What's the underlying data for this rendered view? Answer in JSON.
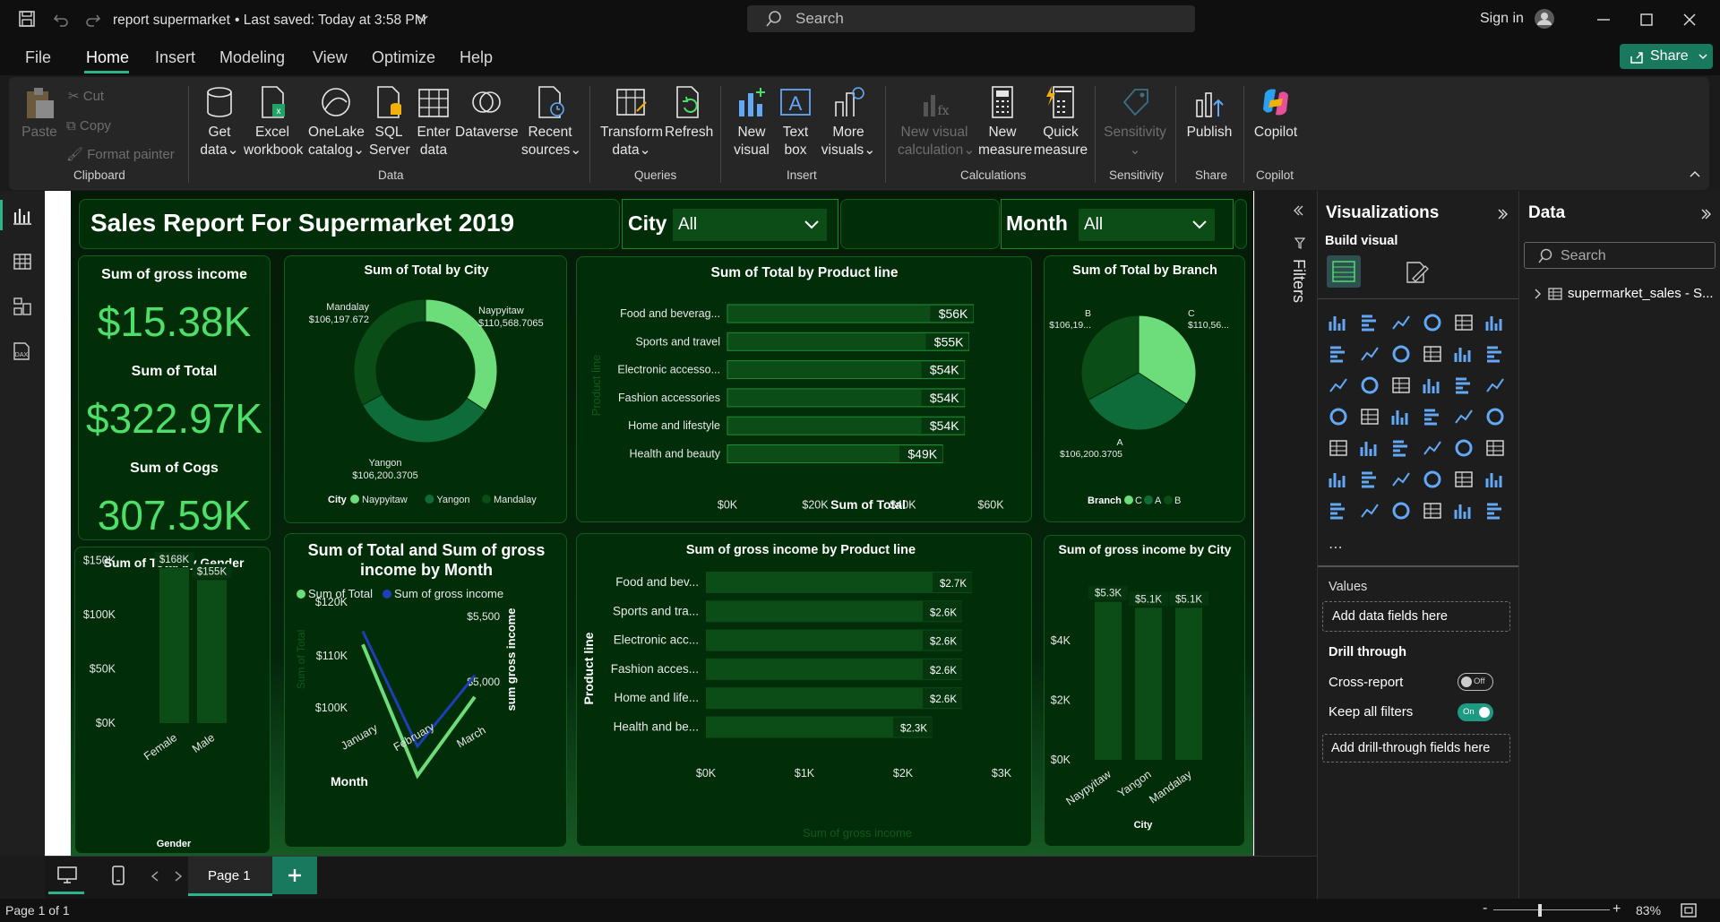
{
  "titlebar": {
    "doc_title": "report supermarket",
    "saved": "• Last saved: Today at 3:58 PM",
    "search": "Search",
    "signin": "Sign in"
  },
  "menu": {
    "items": [
      "File",
      "Home",
      "Insert",
      "Modeling",
      "View",
      "Optimize",
      "Help"
    ],
    "active": "Home",
    "share": "Share"
  },
  "ribbon": {
    "clipboard": {
      "paste": "Paste",
      "cut": "Cut",
      "copy": "Copy",
      "format_painter": "Format painter",
      "group": "Clipboard"
    },
    "data": {
      "get_data": "Get",
      "get_data2": "data",
      "excel": "Excel",
      "excel2": "workbook",
      "onelake": "OneLake",
      "onelake2": "catalog",
      "sql": "SQL",
      "sql2": "Server",
      "enter": "Enter",
      "enter2": "data",
      "dataverse": "Dataverse",
      "recent": "Recent",
      "recent2": "sources",
      "group": "Data"
    },
    "queries": {
      "transform": "Transform",
      "transform2": "data",
      "refresh": "Refresh",
      "group": "Queries"
    },
    "insert": {
      "new_visual": "New",
      "new_visual2": "visual",
      "textbox": "Text",
      "textbox2": "box",
      "more": "More",
      "more2": "visuals",
      "group": "Insert"
    },
    "calc": {
      "nvc": "New visual",
      "nvc2": "calculation",
      "nm": "New",
      "nm2": "measure",
      "qm": "Quick",
      "qm2": "measure",
      "group": "Calculations"
    },
    "sensitivity": {
      "label": "Sensitivity",
      "group": "Sensitivity"
    },
    "share": {
      "publish": "Publish",
      "group": "Share"
    },
    "copilot": {
      "label": "Copilot",
      "group": "Copilot"
    }
  },
  "report": {
    "title": "Sales Report For Supermarket 2019",
    "city_slicer": {
      "label": "City",
      "value": "All"
    },
    "month_slicer": {
      "label": "Month",
      "value": "All"
    },
    "kpi": {
      "gi_label": "Sum of gross income",
      "gi_value": "$15.38K",
      "total_label": "Sum of Total",
      "total_value": "$322.97K",
      "cogs_label": "Sum of Cogs",
      "cogs_value": "307.59K"
    }
  },
  "colors": {
    "bright": "#6ddc7b",
    "mid": "#0e6b3a",
    "dark": "#0a4d16",
    "bg": "#022d09",
    "bar": "#0b4c17",
    "blue": "#1e3fb7"
  },
  "chart_data": [
    {
      "type": "pie",
      "title": "Sum of Total by City",
      "legend_title": "City",
      "slices": [
        {
          "name": "Naypyitaw",
          "value": 110568.7065,
          "label": "$110,568.7065"
        },
        {
          "name": "Yangon",
          "value": 106200.3705,
          "label": "$106,200.3705"
        },
        {
          "name": "Mandalay",
          "value": 106197.672,
          "label": "$106,197.672"
        }
      ]
    },
    {
      "type": "bar",
      "title": "Sum of Total by Product line",
      "xlabel": "Sum of Total",
      "ylabel": "Product line",
      "categories": [
        "Food and beverag...",
        "Sports and travel",
        "Electronic accesso...",
        "Fashion accessories",
        "Home and lifestyle",
        "Health and beauty"
      ],
      "values": [
        56,
        55,
        54,
        54,
        54,
        49
      ],
      "labels": [
        "$56K",
        "$55K",
        "$54K",
        "$54K",
        "$54K",
        "$49K"
      ],
      "ticks": [
        "$0K",
        "$20K",
        "$40K",
        "$60K"
      ],
      "xlim": [
        0,
        60
      ]
    },
    {
      "type": "pie",
      "title": "Sum of Total by Branch",
      "legend_title": "Branch",
      "slices": [
        {
          "name": "C",
          "value": 110568,
          "label": "$110,56..."
        },
        {
          "name": "A",
          "value": 106200.3705,
          "label": "$106,200.3705"
        },
        {
          "name": "B",
          "value": 106197,
          "label": "$106,19..."
        }
      ]
    },
    {
      "type": "bar",
      "title": "Sum of Total by Gender",
      "xlabel": "Gender",
      "categories": [
        "Female",
        "Male"
      ],
      "values": [
        168,
        155
      ],
      "labels": [
        "$168K",
        "$155K"
      ],
      "ticks": [
        "$0K",
        "$50K",
        "$100K",
        "$150K"
      ],
      "ylim": [
        0,
        170
      ]
    },
    {
      "type": "line",
      "title": "Sum of Total and Sum of gross income by Month",
      "xlabel": "Month",
      "ylabel": "Sum of Total",
      "y2label": "sum gross income",
      "categories": [
        "January",
        "February",
        "March"
      ],
      "series": [
        {
          "name": "Sum of Total",
          "values": [
            117.5,
            97.5,
            109.5
          ]
        },
        {
          "name": "Sum of gross income",
          "values": [
            5540,
            4630,
            5190
          ]
        }
      ],
      "yticks": [
        "$100K",
        "$110K",
        "$120K"
      ],
      "y2ticks": [
        "$5,000",
        "$5,500"
      ]
    },
    {
      "type": "bar",
      "title": "Sum of gross income by Product line",
      "xlabel": "Sum of gross income",
      "ylabel": "Product line",
      "categories": [
        "Food and bev...",
        "Sports and tra...",
        "Electronic acc...",
        "Fashion acces...",
        "Home and life...",
        "Health and be..."
      ],
      "values": [
        2.7,
        2.6,
        2.6,
        2.6,
        2.6,
        2.3
      ],
      "labels": [
        "$2.7K",
        "$2.6K",
        "$2.6K",
        "$2.6K",
        "$2.6K",
        "$2.3K"
      ],
      "ticks": [
        "$0K",
        "$1K",
        "$2K",
        "$3K"
      ],
      "xlim": [
        0,
        3
      ]
    },
    {
      "type": "bar",
      "title": "Sum of gross income by City",
      "xlabel": "City",
      "categories": [
        "Naypyitaw",
        "Yangon",
        "Mandalay"
      ],
      "values": [
        5.3,
        5.1,
        5.1
      ],
      "labels": [
        "$5.3K",
        "$5.1K",
        "$5.1K"
      ],
      "ticks": [
        "$0K",
        "$2K",
        "$4K"
      ],
      "ylim": [
        0,
        5.5
      ]
    }
  ],
  "filters": {
    "label": "Filters"
  },
  "visualizations": {
    "title": "Visualizations",
    "build": "Build visual",
    "values": "Values",
    "add_fields": "Add data fields here",
    "drill": "Drill through",
    "cross": "Cross-report",
    "cross_state": "Off",
    "keep": "Keep all filters",
    "keep_state": "On",
    "add_drill": "Add drill-through fields here"
  },
  "data_pane": {
    "title": "Data",
    "search": "Search",
    "table": "supermarket_sales - S..."
  },
  "pages": {
    "page1": "Page 1"
  },
  "status": {
    "page": "Page 1 of 1",
    "zoom": "83%"
  }
}
